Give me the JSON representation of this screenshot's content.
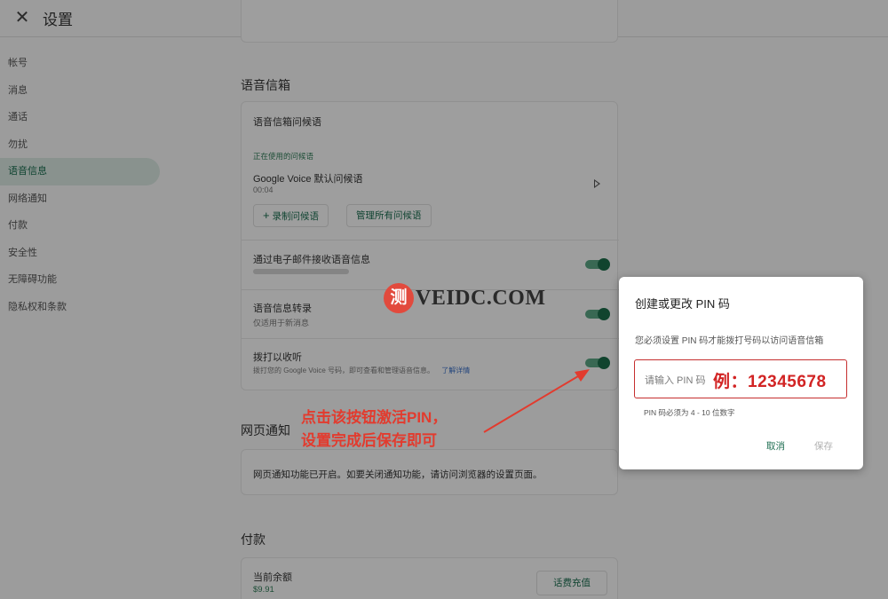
{
  "header": {
    "title": "设置"
  },
  "sidebar": {
    "items": [
      "帐号",
      "消息",
      "通话",
      "勿扰",
      "语音信息",
      "网络通知",
      "付款",
      "安全性",
      "无障碍功能",
      "隐私权和条款"
    ],
    "active_index": 4
  },
  "voicemail": {
    "section_title": "语音信箱",
    "greeting_header": "语音信箱问候语",
    "in_use_label": "正在使用的问候语",
    "greeting_name": "Google Voice 默认问候语",
    "greeting_duration": "00:04",
    "record_button": "录制问候语",
    "manage_button": "管理所有问候语",
    "email_row": {
      "label": "通过电子邮件接收语音信息",
      "enabled": true
    },
    "transcribe_row": {
      "label": "语音信息转录",
      "sub": "仅适用于新消息",
      "enabled": true
    },
    "dial_row": {
      "label": "拨打以收听",
      "sub": "拨打您的 Google Voice 号码，即可查看和管理语音信息。",
      "link": "了解详情",
      "enabled": true
    }
  },
  "web_notifications": {
    "section_title": "网页通知",
    "text": "网页通知功能已开启。如要关闭通知功能，请访问浏览器的设置页面。"
  },
  "payments": {
    "section_title": "付款",
    "balance_label": "当前余额",
    "balance_value": "$9.91",
    "topup_button": "话费充值"
  },
  "dialog": {
    "title": "创建或更改 PIN 码",
    "description": "您必须设置 PIN 码才能拨打号码以访问语音信箱",
    "placeholder": "请输入 PIN 码",
    "example": "例：12345678",
    "hint": "PIN 码必须为 4 - 10 位数字",
    "cancel": "取消",
    "save": "保存"
  },
  "annotation": {
    "line1": "点击该按钮激活PIN，",
    "line2": "设置完成后保存即可",
    "color": "#e23b2e"
  },
  "watermark": {
    "badge": "测",
    "text": "VEIDC.COM"
  },
  "colors": {
    "accent": "#1a6b4e",
    "toggle_on": "#1c6b49",
    "error": "#c62f2f"
  }
}
